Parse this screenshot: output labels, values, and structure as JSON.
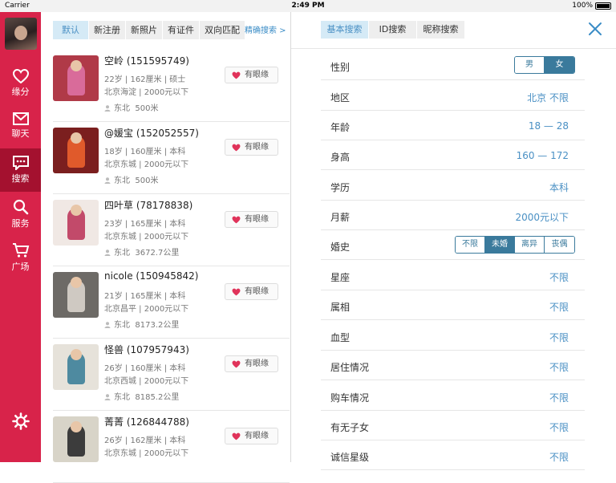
{
  "statusbar": {
    "carrier": "Carrier",
    "time": "2:49 PM",
    "battery": "100%"
  },
  "sidebar": {
    "items": [
      {
        "label": "缘分",
        "icon": "heart-icon"
      },
      {
        "label": "聊天",
        "icon": "mail-icon"
      },
      {
        "label": "搜索",
        "icon": "chat-bubble-icon",
        "active": true
      },
      {
        "label": "服务",
        "icon": "search-icon"
      },
      {
        "label": "广场",
        "icon": "cart-icon"
      }
    ],
    "settings_icon": "gear-icon"
  },
  "list": {
    "tabs": [
      "默认",
      "新注册",
      "新照片",
      "有证件",
      "双向匹配"
    ],
    "active_tab": "默认",
    "precise_search": "精确搜索 >",
    "like_label": "有眼缘",
    "users": [
      {
        "name": "空岭 (151595749)",
        "info1": "22岁 | 162厘米 | 硕士",
        "info2": "北京海淀 | 2000元以下",
        "dist_dir": "东北",
        "dist": "500米"
      },
      {
        "name": "@媛宝 (152052557)",
        "info1": "18岁 | 160厘米 | 本科",
        "info2": "北京东城 | 2000元以下",
        "dist_dir": "东北",
        "dist": "500米"
      },
      {
        "name": "四叶草 (78178838)",
        "info1": "23岁 | 165厘米 | 本科",
        "info2": "北京东城 | 2000元以下",
        "dist_dir": "东北",
        "dist": "3672.7公里"
      },
      {
        "name": "nicole (150945842)",
        "info1": "21岁 | 165厘米 | 本科",
        "info2": "北京昌平 | 2000元以下",
        "dist_dir": "东北",
        "dist": "8173.2公里"
      },
      {
        "name": "怪兽 (107957943)",
        "info1": "26岁 | 160厘米 | 本科",
        "info2": "北京西城 | 2000元以下",
        "dist_dir": "东北",
        "dist": "8185.2公里"
      },
      {
        "name": "菁菁 (126844788)",
        "info1": "26岁 | 162厘米 | 本科",
        "info2": "北京东城 | 2000元以下",
        "dist_dir": "",
        "dist": ""
      }
    ]
  },
  "filter": {
    "tabs": [
      "基本搜索",
      "ID搜索",
      "昵称搜索"
    ],
    "active_tab": "基本搜索",
    "gender": {
      "label": "性别",
      "options": [
        "男",
        "女"
      ],
      "selected": "女"
    },
    "region": {
      "label": "地区",
      "value": "北京 不限"
    },
    "age": {
      "label": "年龄",
      "value": "18 — 28"
    },
    "height": {
      "label": "身高",
      "value": "160 — 172"
    },
    "education": {
      "label": "学历",
      "value": "本科"
    },
    "salary": {
      "label": "月薪",
      "value": "2000元以下"
    },
    "marriage": {
      "label": "婚史",
      "options": [
        "不限",
        "未婚",
        "离异",
        "丧偶"
      ],
      "selected": "未婚"
    },
    "constellation": {
      "label": "星座",
      "value": "不限"
    },
    "zodiac": {
      "label": "属相",
      "value": "不限"
    },
    "blood": {
      "label": "血型",
      "value": "不限"
    },
    "housing": {
      "label": "居住情况",
      "value": "不限"
    },
    "car": {
      "label": "购车情况",
      "value": "不限"
    },
    "children": {
      "label": "有无子女",
      "value": "不限"
    },
    "credit": {
      "label": "诚信星级",
      "value": "不限"
    }
  }
}
